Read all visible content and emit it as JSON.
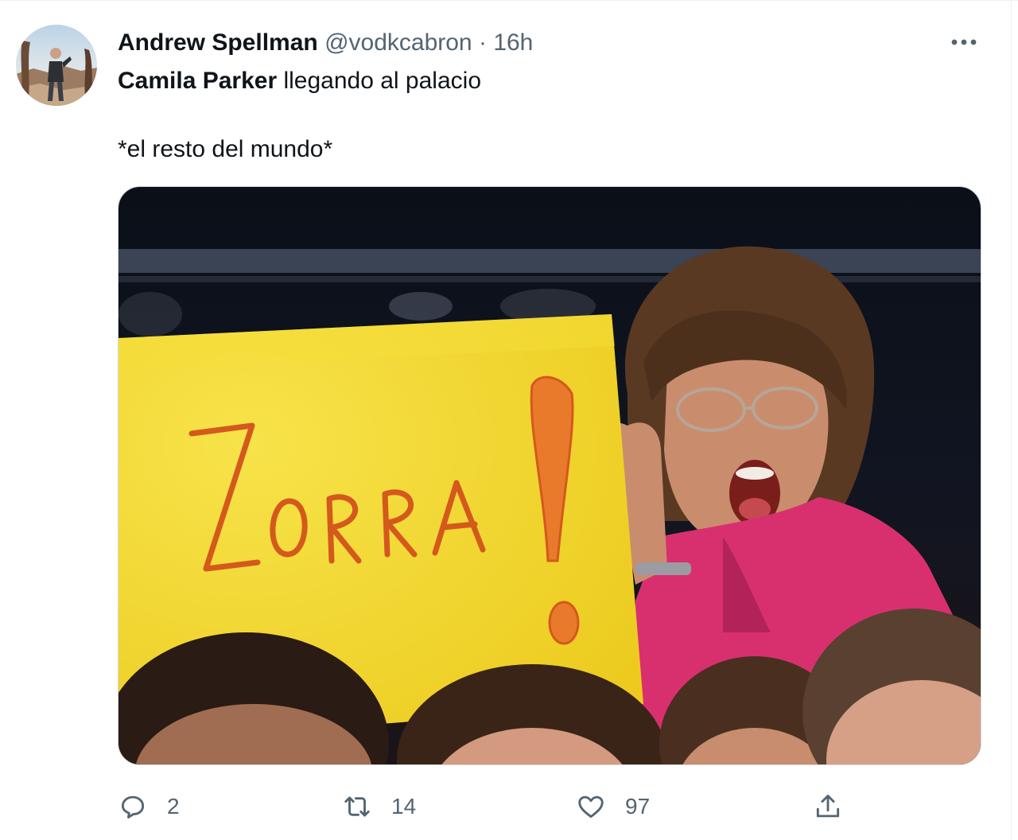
{
  "tweet": {
    "author_name": "Andrew Spellman",
    "author_handle": "@vodkcabron",
    "separator": "·",
    "time": "16h",
    "text_bold": "Camila Parker",
    "text_rest": " llegando al palacio",
    "text_line2": "*el resto del mundo*",
    "media_sign_text": "ZORRA",
    "media_sign_punct": "!"
  },
  "actions": {
    "reply_count": "2",
    "retweet_count": "14",
    "like_count": "97"
  },
  "icons": {
    "more": "more-horizontal-icon",
    "reply": "reply-icon",
    "retweet": "retweet-icon",
    "like": "heart-icon",
    "share": "share-icon"
  },
  "colors": {
    "text_primary": "#0f1419",
    "text_secondary": "#536471",
    "sign_yellow": "#f2d52a",
    "sign_ink": "#d4591c",
    "shirt_pink": "#d8306f"
  }
}
